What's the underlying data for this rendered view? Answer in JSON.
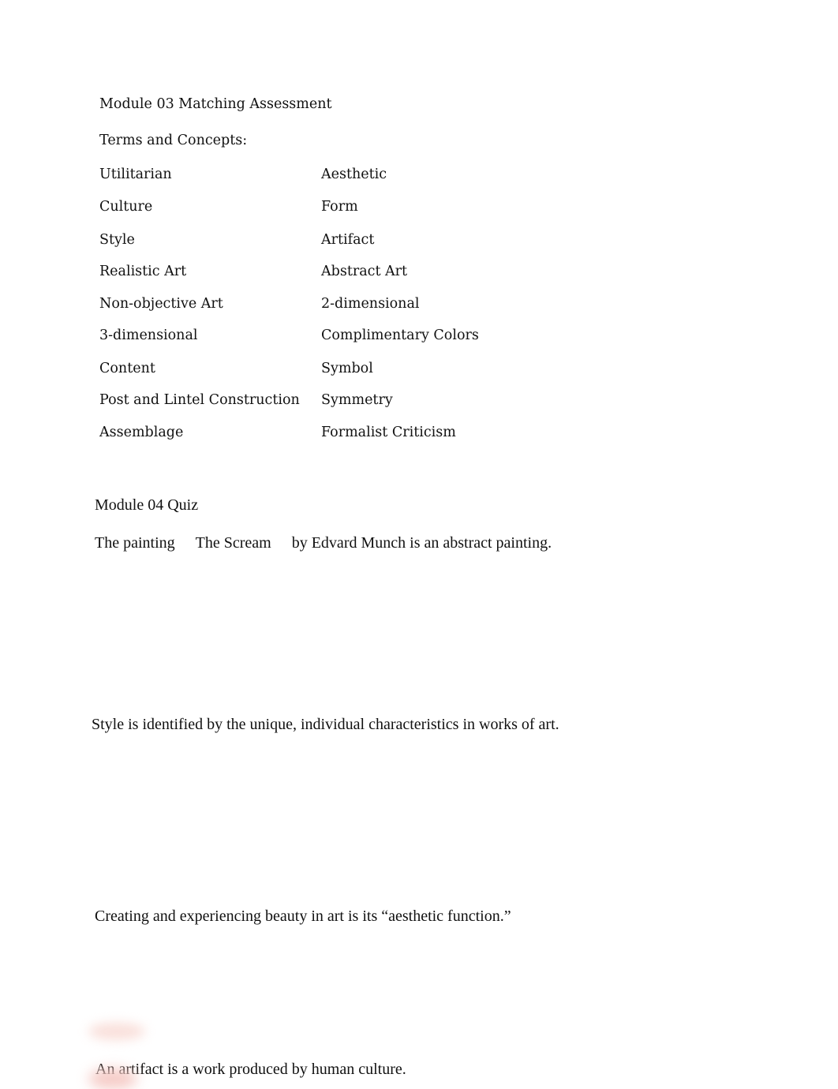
{
  "document": {
    "background_color": "#ffffff",
    "text_color": "#111111"
  },
  "section_matching": {
    "title": "Module 03 Matching Assessment",
    "subtitle": "Terms and Concepts:",
    "terms": [
      {
        "left": "Utilitarian",
        "right": "Aesthetic"
      },
      {
        "left": "Culture",
        "right": "Form"
      },
      {
        "left": "Style",
        "right": "Artifact"
      },
      {
        "left": "Realistic Art",
        "right": "Abstract Art"
      },
      {
        "left": "Non-objective Art",
        "right": "2-dimensional"
      },
      {
        "left": "3-dimensional",
        "right": "Complimentary Colors"
      },
      {
        "left": "Content",
        "right": "Symbol"
      },
      {
        "left": "Post and Lintel Construction",
        "right": "Symmetry"
      },
      {
        "left": "Assemblage",
        "right": "Formalist Criticism"
      }
    ]
  },
  "section_quiz": {
    "title": "Module 04 Quiz",
    "question_painting": {
      "prefix": "The painting",
      "artwork": "The Scream",
      "suffix": "by Edvard Munch is an abstract painting."
    },
    "statement_style": "Style is identified by the unique, individual characteristics in works of art.",
    "statement_aesthetic": "Creating and experiencing beauty in art is its “aesthetic function.”",
    "statement_artifact": "An artifact is a work produced by human culture."
  },
  "artifacts": {
    "smudge_upper_color": "#f9ded9",
    "smudge_lower_color": "#f5c9c4"
  }
}
